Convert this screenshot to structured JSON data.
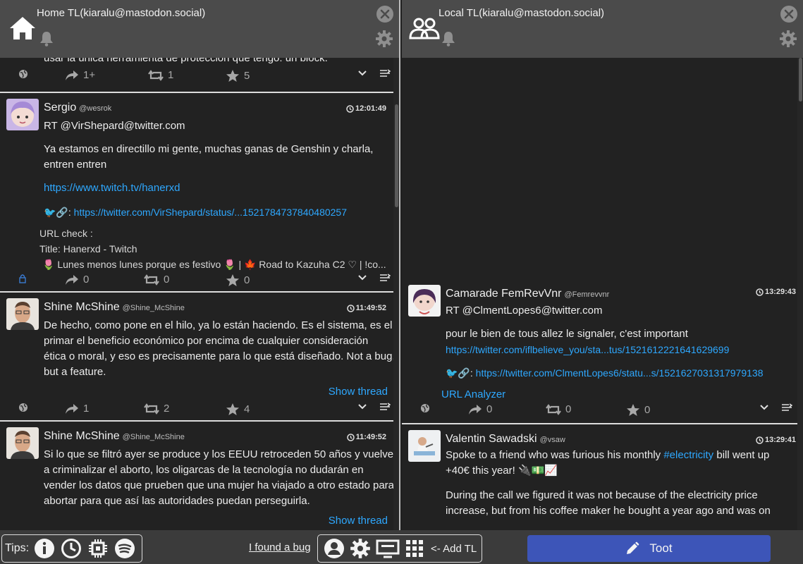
{
  "columns": [
    {
      "title": "Home TL(kiaralu@mastodon.social)",
      "icon": "home-icon",
      "toots": [
        {
          "partial_text": "usar la única herramienta de protección que tengo: un block.",
          "visibility_icon": "globe-icon",
          "reblog_count": "1+",
          "boost_count": "1",
          "fav_count": "5"
        },
        {
          "name": "Sergio",
          "acct": "@wesrok",
          "time": "12:01:49",
          "rt": "RT @VirShepard@twitter.com",
          "text1": "Ya estamos en directillo mi gente, muchas ganas de Genshin y charla,",
          "text2": "entren entren",
          "link1": "https://www.twitch.tv/hanerxd",
          "link2_prefix": "🐦🔗:",
          "link2": "https://twitter.com/VirShepard/status/...1521784737840480257",
          "url_check": "URL check :",
          "url_title": "Title: Hanerxd - Twitch",
          "url_desc": "🌷 Lunes menos lunes porque es festivo 🌷 | 🍁 Road to Kazuha C2 ♡ | !co...",
          "visibility_icon": "lock-icon",
          "reblog_count": "0",
          "boost_count": "0",
          "fav_count": "0"
        },
        {
          "name": "Shine McShine",
          "acct": "@Shine_McShine",
          "time": "11:49:52",
          "lines": [
            "De hecho, como pone en el hilo, ya lo están haciendo. Es el sistema, es el",
            "primar el beneficio económico por encima de cualquier consideración",
            "ética o moral, y eso es precisamente para lo que está diseñado. Not a bug,",
            "but a feature."
          ],
          "show_thread": "Show thread",
          "visibility_icon": "globe-icon",
          "reblog_count": "1",
          "boost_count": "2",
          "fav_count": "4"
        },
        {
          "name": "Shine McShine",
          "acct": "@Shine_McShine",
          "time": "11:49:52",
          "lines": [
            "Si lo que se filtró ayer se produce y los EEUU retroceden 50 años y vuelven",
            "a criminalizar el aborto, los oligarcas de la tecnología no dudarán en",
            "vender los datos que prueben que una mujer ha viajado a otro estado para",
            "abortar para que así las autoridades puedan perseguirla."
          ],
          "show_thread": "Show thread"
        }
      ]
    },
    {
      "title": "Local TL(kiaralu@mastodon.social)",
      "icon": "users-icon",
      "toots": [
        {
          "name": "Camarade FemRevVnr",
          "acct": "@Femrevvnr",
          "time": "13:29:43",
          "rt": "RT @ClmentLopes6@twitter.com",
          "text1": "pour le bien de tous allez le signaler, c'est important",
          "link1": "https://twitter.com/iflbelieve_you/sta...tus/1521612221641629699",
          "link2_prefix": "🐦🔗:",
          "link2": "https://twitter.com/ClmentLopes6/statu...s/1521627031317979138",
          "url_analyzer": "URL Analyzer",
          "visibility_icon": "globe-icon",
          "reblog_count": "0",
          "boost_count": "0",
          "fav_count": "0"
        },
        {
          "name": "Valentin Sawadski",
          "acct": "@vsaw",
          "time": "13:29:41",
          "line1_pre": "Spoke to a friend who was furious his monthly ",
          "hashtag": "#electricity",
          "line1_post": " bill went up",
          "line2": "+40€ this year! 🔌💵📈",
          "line3": "During the call we figured it was not because of the electricity price",
          "line4": "increase, but from his coffee maker he bought a year ago and was on"
        }
      ]
    }
  ],
  "bottombar": {
    "tips_label": "Tips:",
    "bug_link": "I found a bug",
    "add_tl": "<- Add TL",
    "toot_label": "Toot"
  },
  "colors": {
    "accent": "#3d55b8",
    "link": "#2ea8ff",
    "header": "#4b4b4b"
  }
}
